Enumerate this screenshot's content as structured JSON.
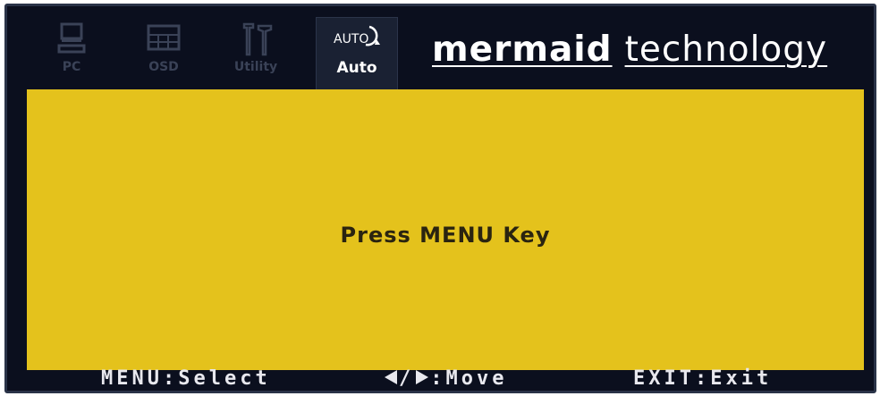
{
  "tabs": [
    {
      "label": "PC",
      "icon": "monitor-icon",
      "active": false
    },
    {
      "label": "OSD",
      "icon": "osd-grid-icon",
      "active": false
    },
    {
      "label": "Utility",
      "icon": "tools-icon",
      "active": false
    },
    {
      "label": "Auto",
      "icon": "auto-adjust-icon",
      "icon_text": "AUTO",
      "active": true
    }
  ],
  "brand": {
    "part1": "mermaid",
    "part2": "technology"
  },
  "panel": {
    "message": "Press MENU Key",
    "background": "#e4c21c"
  },
  "footer": {
    "select": "MENU:Select",
    "move_suffix": ":Move",
    "exit": "EXIT:Exit"
  },
  "colors": {
    "background": "#0b0f1e",
    "panel": "#e4c21c",
    "inactive_icon": "#3a4257",
    "text": "#ffffff"
  }
}
